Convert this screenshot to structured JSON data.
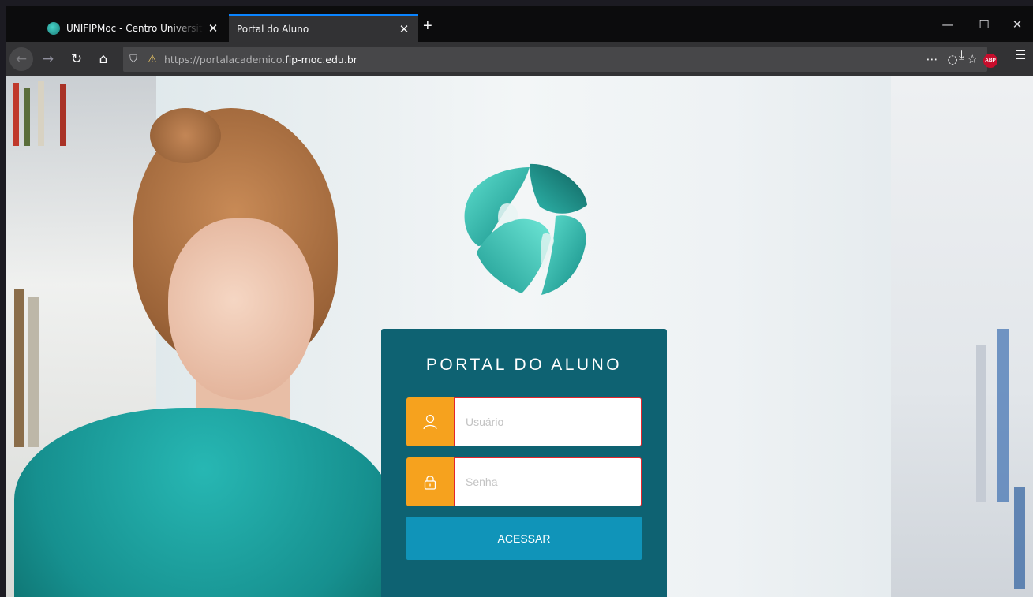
{
  "browser": {
    "tabs": [
      {
        "title": "UNIFIPMoc - Centro Universitá",
        "close": "✕"
      },
      {
        "title": "Portal do Aluno",
        "close": "✕"
      }
    ],
    "new_tab": "+",
    "window_controls": {
      "minimize": "—",
      "maximize": "☐",
      "close": "✕"
    },
    "url": {
      "scheme": "https://portalacademico.",
      "host": "fip-moc.edu.br"
    },
    "toolbar_icons": [
      "back-icon",
      "forward-icon",
      "reload-icon",
      "home-icon",
      "shield-icon",
      "lock-warning-icon",
      "more-icon",
      "pocket-icon",
      "bookmark-star-icon",
      "downloads-icon",
      "adblock-icon",
      "menu-icon"
    ],
    "adblock_label": "ABP"
  },
  "login": {
    "title": "PORTAL DO ALUNO",
    "username_placeholder": "Usuário",
    "password_placeholder": "Senha",
    "submit_label": "ACESSAR"
  },
  "colors": {
    "card": "#0e6272",
    "icon_box": "#f6a21e",
    "button": "#1094b9",
    "input_border": "#e3262c"
  }
}
